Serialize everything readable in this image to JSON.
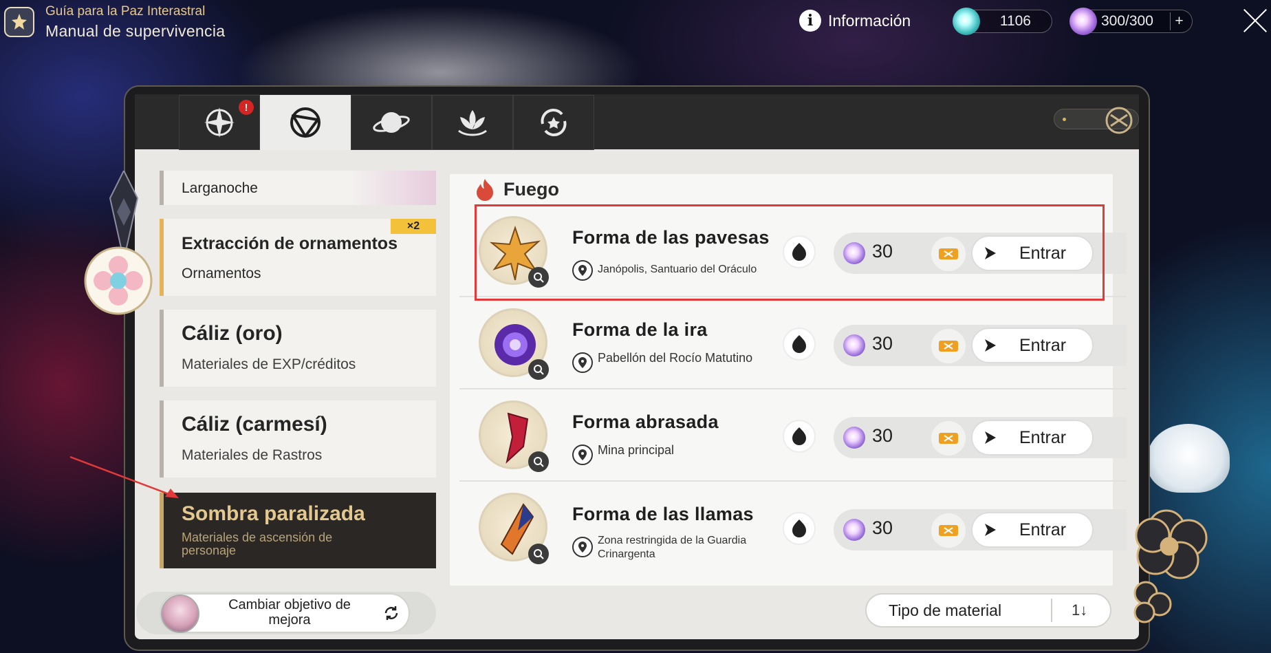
{
  "header": {
    "subtitle": "Guía para la Paz Interastral",
    "title": "Manual de supervivencia",
    "info_label": "Información",
    "stellar_jade": "1106",
    "trailblaze_power": "300/300",
    "add_symbol": "+"
  },
  "tabs": [
    {
      "name": "tab-operation-briefing",
      "icon": "compass-star-icon",
      "alert": "!"
    },
    {
      "name": "tab-daily-training",
      "icon": "target-icon",
      "active": true
    },
    {
      "name": "tab-planet",
      "icon": "planet-icon"
    },
    {
      "name": "tab-lotus",
      "icon": "lotus-icon"
    },
    {
      "name": "tab-achievements",
      "icon": "refresh-star-icon"
    }
  ],
  "sidebar": {
    "items": [
      {
        "title": "Larganoche",
        "subtitle": ""
      },
      {
        "title": "Extracción de ornamentos",
        "subtitle": "Ornamentos",
        "badge": "×2"
      },
      {
        "title": "Cáliz (oro)",
        "subtitle": "Materiales de EXP/créditos"
      },
      {
        "title": "Cáliz (carmesí)",
        "subtitle": "Materiales de Rastros"
      },
      {
        "title": "Sombra paralizada",
        "subtitle": "Materiales de ascensión de personaje",
        "selected": true
      }
    ]
  },
  "section": {
    "title": "Fuego",
    "icon": "fire-element-icon"
  },
  "stages": [
    {
      "name": "Forma de las pavesas",
      "location": "Janópolis, Santuario del Oráculo",
      "cost": "30",
      "enter": "Entrar",
      "highlighted": true
    },
    {
      "name": "Forma de la ira",
      "location": "Pabellón del Rocío Matutino",
      "cost": "30",
      "enter": "Entrar"
    },
    {
      "name": "Forma abrasada",
      "location": "Mina principal",
      "cost": "30",
      "enter": "Entrar"
    },
    {
      "name": "Forma de las llamas",
      "location": "Zona restringida de la Guardia Crinargenta",
      "cost": "30",
      "enter": "Entrar"
    }
  ],
  "footer": {
    "upgrade_label": "Cambiar objetivo de mejora",
    "sort_label": "Tipo de material",
    "sort_icon": "1↓"
  },
  "colors": {
    "highlight": "#e23a3a",
    "selected_gold": "#e3c98f",
    "badge": "#f3c13a"
  }
}
